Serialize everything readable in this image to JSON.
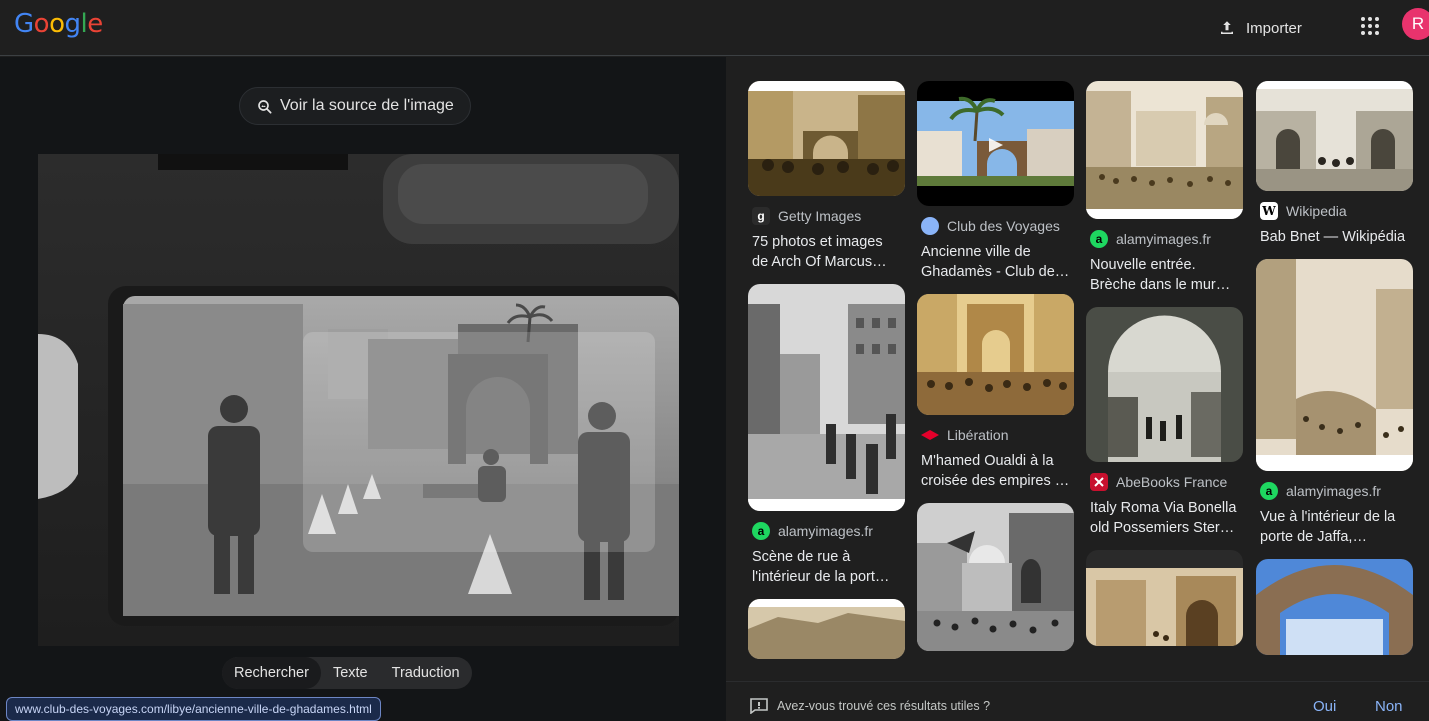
{
  "header": {
    "logo_letters": [
      "G",
      "o",
      "o",
      "g",
      "l",
      "e"
    ],
    "upload_label": "Importer",
    "avatar_initial": "R"
  },
  "left_panel": {
    "source_button_label": "Voir la source de l'image",
    "modes": [
      "Rechercher",
      "Texte",
      "Traduction"
    ],
    "active_mode": "Rechercher",
    "status_url": "www.club-des-voyages.com/libye/ancienne-ville-de-ghadames.html"
  },
  "results": {
    "col1": [
      {
        "source": "Getty Images",
        "title": "75 photos et images de Arch Of Marcus…",
        "favicon": "g"
      },
      {
        "source": "alamyimages.fr",
        "title": "Scène de rue à l'intérieur de la port…",
        "favicon": "a"
      }
    ],
    "col2": [
      {
        "source": "Club des Voyages",
        "title": "Ancienne ville de Ghadamès - Club de…"
      },
      {
        "source": "Libération",
        "title": "M'hamed Oualdi à la croisée des empires …"
      }
    ],
    "col3": [
      {
        "source": "alamyimages.fr",
        "title": "Nouvelle entrée. Brèche dans le mur…",
        "favicon": "a"
      },
      {
        "source": "AbeBooks France",
        "title": "Italy Roma Via Bonella old Possemiers Ster…"
      }
    ],
    "col4": [
      {
        "source": "Wikipedia",
        "title": "Bab Bnet — Wikipédia",
        "favicon": "W"
      },
      {
        "source": "alamyimages.fr",
        "title": "Vue à l'intérieur de la porte de Jaffa,…",
        "favicon": "a"
      }
    ]
  },
  "feedback": {
    "question": "Avez-vous trouvé ces résultats utiles ?",
    "yes": "Oui",
    "no": "Non"
  },
  "colors": {
    "accent": "#8ab4f8",
    "avatar": "#e8336d",
    "alamy_green": "#1ed760",
    "liberation_red": "#e4002b"
  }
}
